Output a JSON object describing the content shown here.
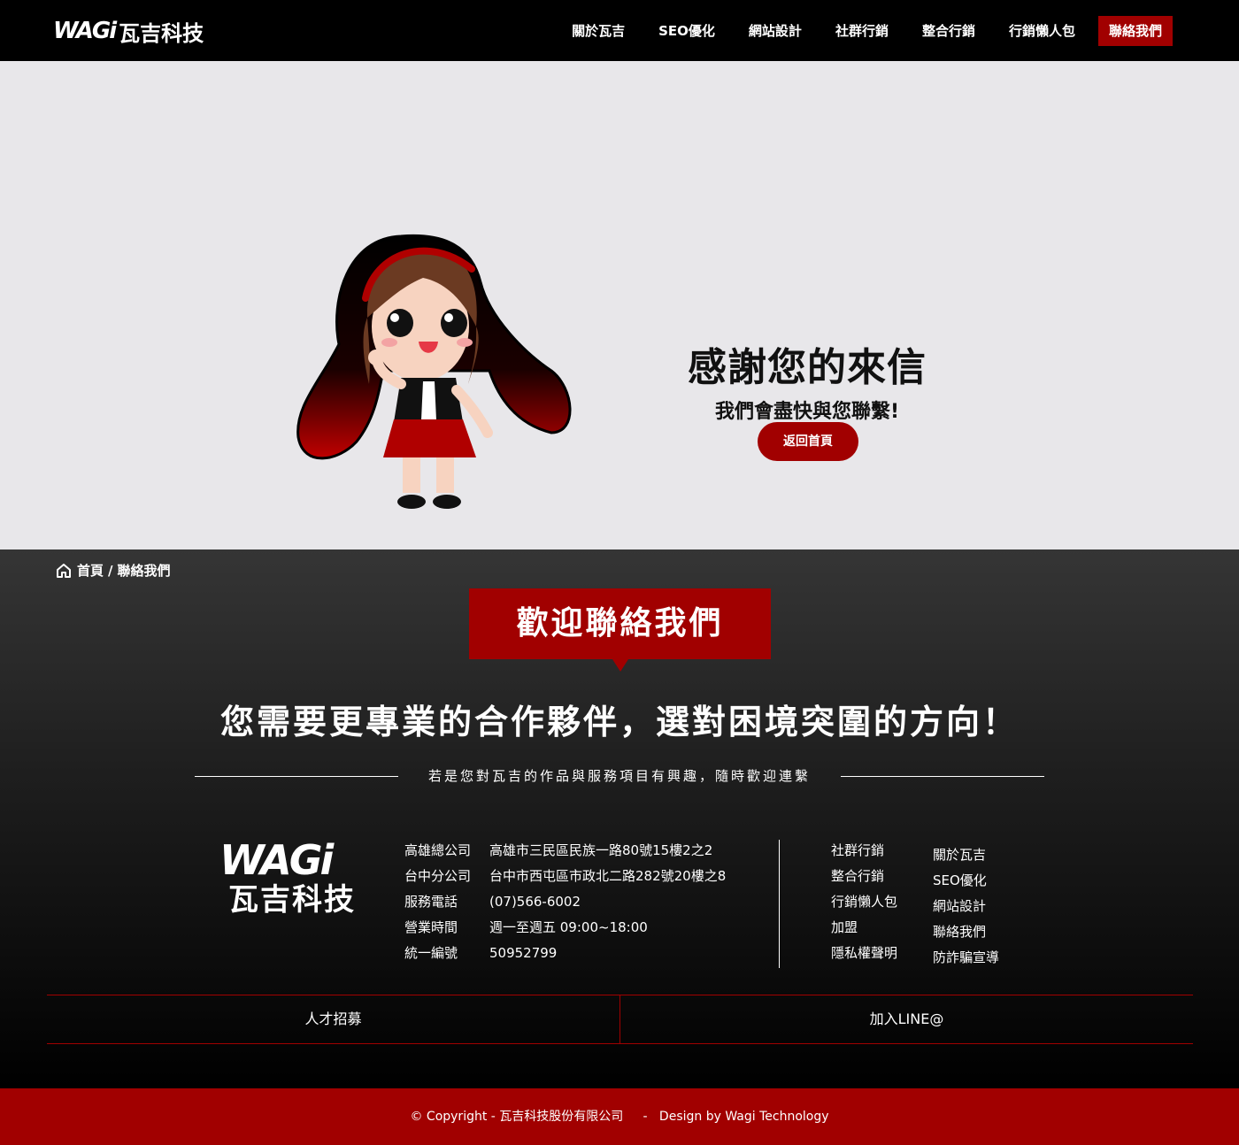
{
  "header": {
    "logo_mark": "WAGi",
    "logo_text": "瓦吉科技",
    "nav": [
      {
        "label": "關於瓦吉"
      },
      {
        "label": "SEO優化"
      },
      {
        "label": "網站設計"
      },
      {
        "label": "社群行銷"
      },
      {
        "label": "整合行銷"
      },
      {
        "label": "行銷懶人包"
      },
      {
        "label": "聯絡我們"
      }
    ]
  },
  "hero": {
    "title": "感謝您的來信",
    "subtitle": "我們會盡快與您聯繫!",
    "button": "返回首頁"
  },
  "footer": {
    "breadcrumb": {
      "home": "首頁",
      "separator": "/",
      "current": "聯絡我們"
    },
    "welcome": "歡迎聯絡我們",
    "headline": "您需要更專業的合作夥伴，選對困境突圍的方向！",
    "subline": "若是您對瓦吉的作品與服務項目有興趣，隨時歡迎連繫",
    "logo_mark": "WAGi",
    "logo_text": "瓦吉科技",
    "info": [
      {
        "label": "高雄總公司",
        "value": "高雄市三民區民族一路80號15樓2之2"
      },
      {
        "label": "台中分公司",
        "value": "台中市西屯區市政北二路282號20樓之8"
      },
      {
        "label": "服務電話",
        "value": "(07)566-6002"
      },
      {
        "label": "營業時間",
        "value": "週一至週五 09:00~18:00"
      },
      {
        "label": "統一編號",
        "value": "50952799"
      }
    ],
    "links_col1": [
      "社群行銷",
      "整合行銷",
      "行銷懶人包",
      "加盟",
      "隱私權聲明"
    ],
    "links_col2": [
      "關於瓦吉",
      "SEO優化",
      "網站設計",
      "聯絡我們",
      "防詐騙宣導"
    ],
    "cta": [
      "人才招募",
      "加入LINE@"
    ],
    "copyright": "© Copyright - 瓦吉科技股份有限公司     -   Design by Wagi Technology"
  },
  "colors": {
    "accent": "#a10000",
    "hero_bg": "#e8e7ea",
    "header_bg": "#000000"
  },
  "icons": {
    "home": "home-icon"
  }
}
